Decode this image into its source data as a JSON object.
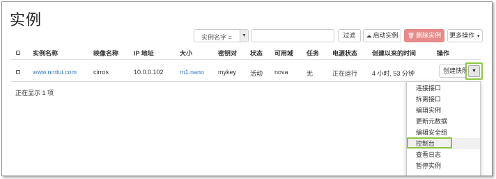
{
  "page": {
    "title": "实例"
  },
  "toolbar": {
    "filter_field": "实例名字 =",
    "filter_value": "",
    "filter_label": "过滤",
    "launch_label": "启动实例",
    "delete_label": "删除实例",
    "more_label": "更多操作",
    "colors": {
      "delete_bg": "#e8898a",
      "highlight": "#8cc63f"
    }
  },
  "table": {
    "headers": [
      "实例名称",
      "映像名称",
      "IP 地址",
      "大小",
      "密钥对",
      "状态",
      "可用域",
      "任务",
      "电源状态",
      "创建以来的时间",
      "操作"
    ],
    "rows": [
      {
        "name": "www.nmtui.com",
        "image": "cirros",
        "ip": "10.0.0.102",
        "size": "m1.nano",
        "keypair": "mykey",
        "status": "活动",
        "zone": "nova",
        "task": "无",
        "power": "正在运行",
        "age": "4 小时, 53 分钟",
        "action": "创建快照"
      }
    ],
    "footer": "正在显示 1 项"
  },
  "action_menu": {
    "items": [
      "连接接口",
      "拆离接口",
      "编辑实例",
      "更新元数据",
      "编辑安全组",
      "控制台",
      "查看日志",
      "暂停实例"
    ],
    "highlighted": "控制台"
  },
  "icons": {
    "launch": "cloud-upload-icon",
    "delete": "trash-icon",
    "more": "caret-down-icon",
    "toggle": "caret-down-icon"
  }
}
